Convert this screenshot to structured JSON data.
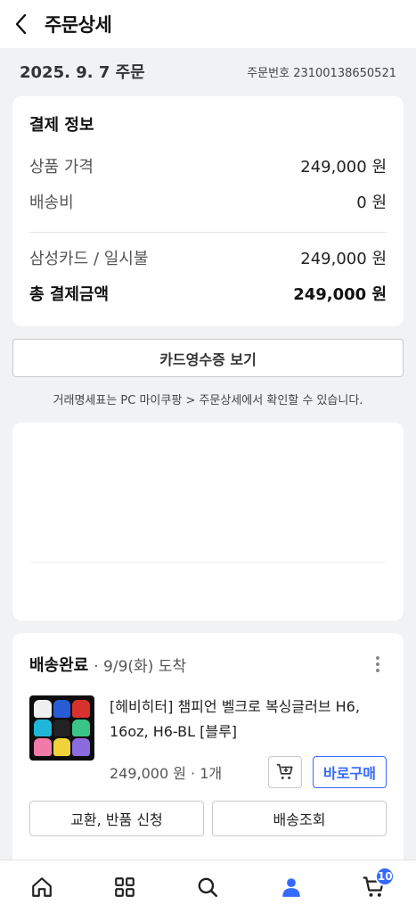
{
  "header": {
    "title": "주문상세"
  },
  "order": {
    "date": "2025. 9. 7 주문",
    "number": "주문번호 23100138650521"
  },
  "payment": {
    "title": "결제 정보",
    "product_price_label": "상품 가격",
    "product_price_value": "249,000 원",
    "shipping_label": "배송비",
    "shipping_value": "0 원",
    "method_label": "삼성카드 / 일시불",
    "method_value": "249,000 원",
    "total_label": "총 결제금액",
    "total_value": "249,000 원"
  },
  "receipt": {
    "button_label": "카드영수증 보기",
    "note": "거래명세표는 PC 마이쿠팡 > 주문상세에서 확인할 수 있습니다."
  },
  "shipment": {
    "status": "배송완료",
    "date": "· 9/9(화) 도착",
    "product_name": "[헤비히터] 챔피언 벨크로 복싱글러브 H6, 16oz, H6-BL [블루]",
    "price_qty": "249,000 원 · 1개",
    "buy_now_label": "바로구매",
    "return_label": "교환, 반품 신청",
    "track_label": "배송조회"
  },
  "tabbar": {
    "cart_badge": "10",
    "accent": "#346aff"
  },
  "icons": [
    "back-arrow-icon",
    "more-vertical-icon",
    "add-to-cart-icon",
    "home-icon",
    "category-icon",
    "search-icon",
    "my-coupang-icon",
    "cart-icon"
  ]
}
